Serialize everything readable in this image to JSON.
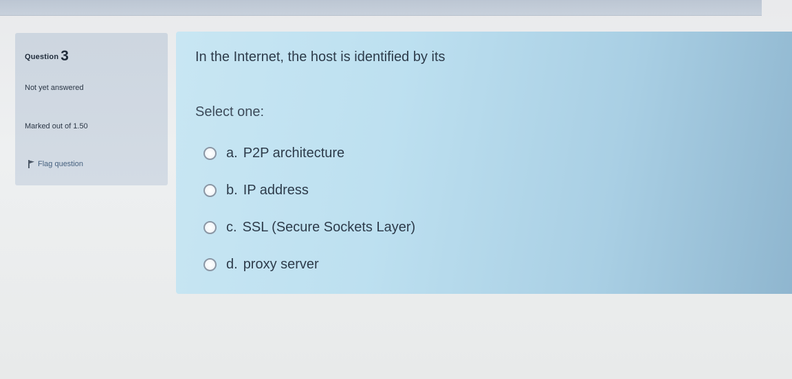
{
  "info": {
    "question_label": "Question",
    "question_number": "3",
    "state": "Not yet answered",
    "grade": "Marked out of 1.50",
    "flag": "Flag question"
  },
  "question": {
    "text": "In the Internet, the host is identified by its",
    "prompt": "Select one:",
    "options": [
      {
        "letter": "a.",
        "text": "P2P architecture"
      },
      {
        "letter": "b.",
        "text": "IP address"
      },
      {
        "letter": "c.",
        "text": "SSL (Secure Sockets Layer)"
      },
      {
        "letter": "d.",
        "text": "proxy server"
      }
    ]
  },
  "colors": {
    "content_panel": "#bde0f0",
    "info_panel": "#d3dbe4",
    "flag_link": "#45607f"
  },
  "icons": {
    "flag": "flag-icon",
    "option": "radio-button"
  }
}
